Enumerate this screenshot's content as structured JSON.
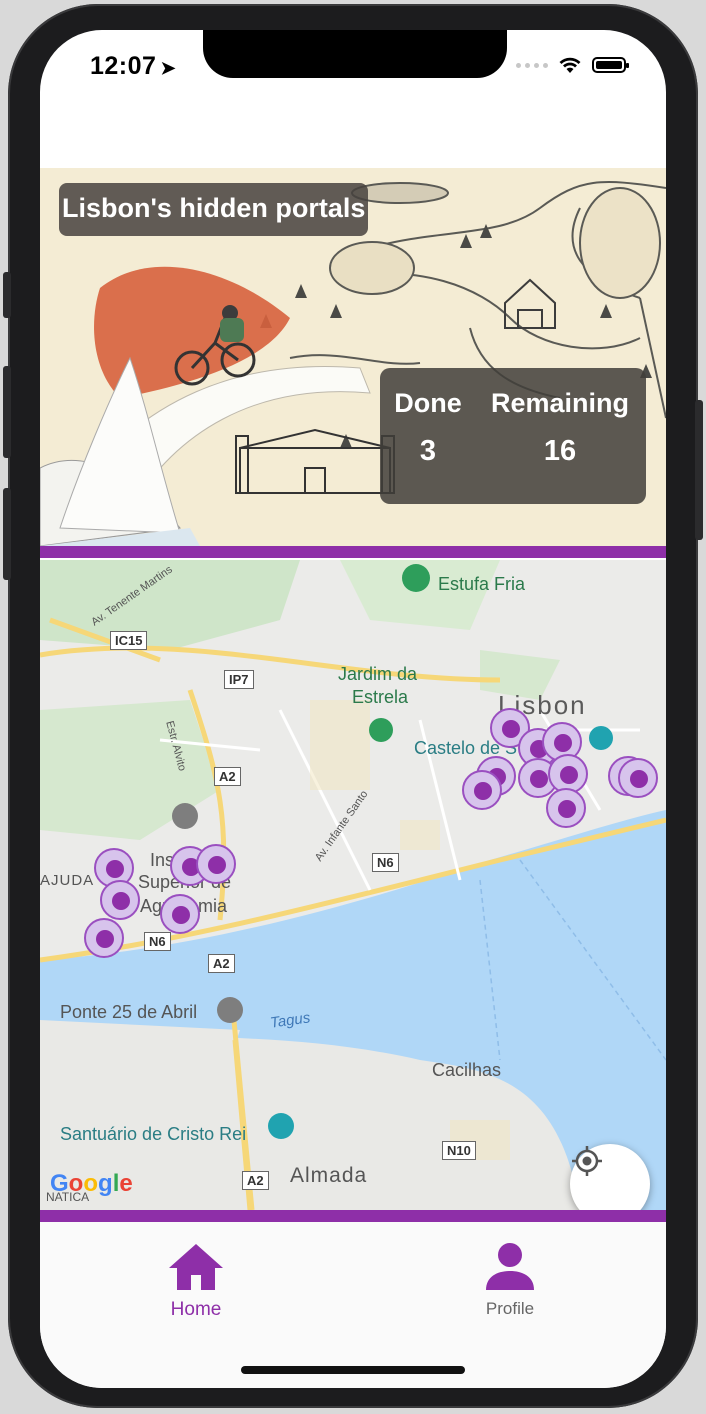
{
  "status_bar": {
    "time": "12:07",
    "location_icon": "location-arrow-icon",
    "wifi_icon": "wifi-icon",
    "battery_icon": "battery-icon"
  },
  "hero": {
    "title": "Lisbon's hidden portals",
    "stats": [
      {
        "label": "Done",
        "value": "3"
      },
      {
        "label": "Remaining",
        "value": "16"
      }
    ]
  },
  "map": {
    "labels": {
      "lisbon": "Lisbon",
      "estufa_fria": "Estufa Fria",
      "jardim_line1": "Jardim da",
      "jardim_line2": "Estrela",
      "castelo": "Castelo de S",
      "instituto_line1": "Ins",
      "instituto_line2": "Superior de",
      "instituto_line3": "Agronomia",
      "ajuda": "AJUDA",
      "ponte": "Ponte 25 de Abril",
      "tagus": "Tagus",
      "cacilhas": "Cacilhas",
      "santuario": "Santuário de Cristo Rei",
      "almada": "Almada",
      "av_martins": "Av. Tenente Martins",
      "estr_alvito": "Estr. Alvito",
      "av_infante": "Av. Infante Santo",
      "natica": "NATICA"
    },
    "road_shields": {
      "ic15": "IC15",
      "ip7": "IP7",
      "a2_top": "A2",
      "a2_mid": "A2",
      "a2_bottom": "A2",
      "n6_right": "N6",
      "n6_left": "N6",
      "n10": "N10"
    },
    "attribution": "Google",
    "locate_icon": "my-location-icon"
  },
  "bottom_nav": {
    "items": [
      {
        "label": "Home",
        "icon": "home-icon",
        "active": true
      },
      {
        "label": "Profile",
        "icon": "person-icon",
        "active": false
      }
    ]
  },
  "colors": {
    "accent": "#8e2fa8",
    "marker_fill": "#d7c4ec",
    "water": "#b0d7f7"
  }
}
